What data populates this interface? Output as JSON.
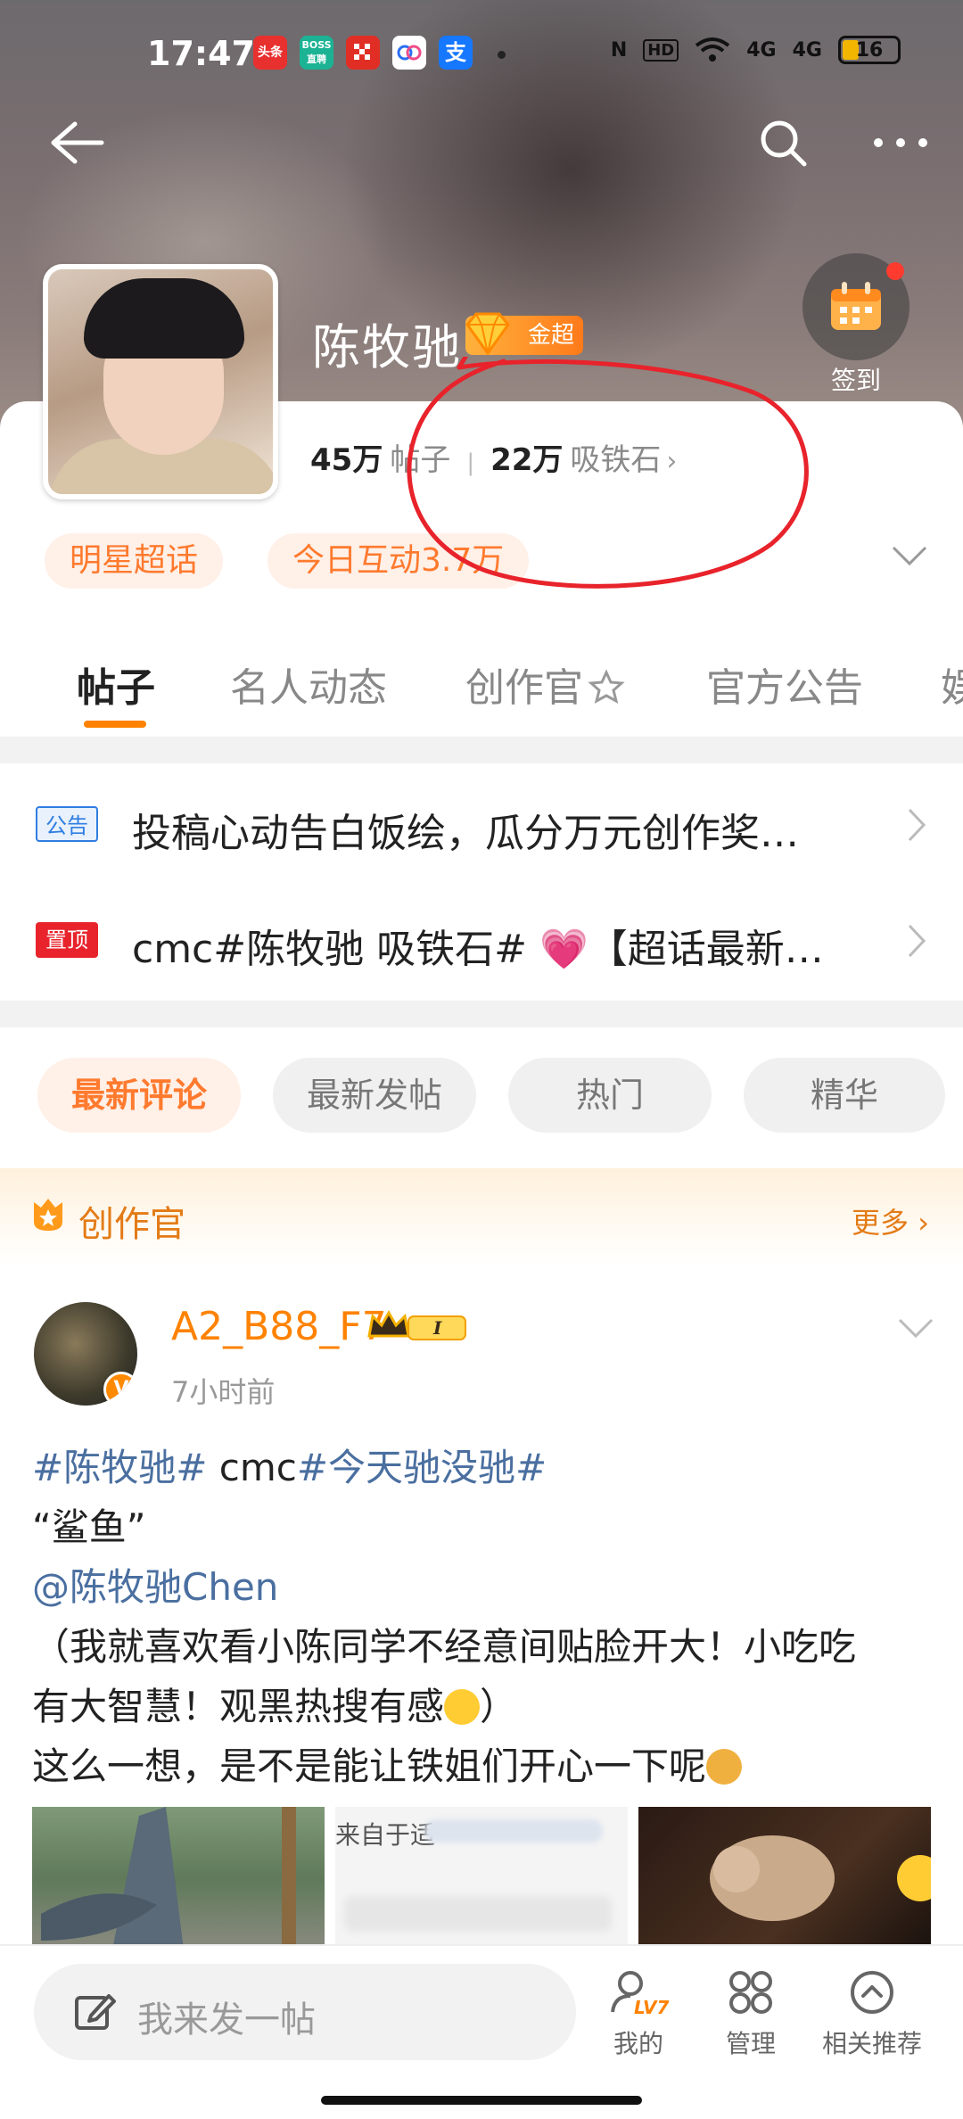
{
  "status_bar": {
    "time": "17:47",
    "apps": [
      "头条",
      "BOSS直聘",
      "多多",
      "百度网盘",
      "支"
    ],
    "network": [
      "N",
      "HD",
      "4G",
      "4G"
    ],
    "battery": "16"
  },
  "header": {
    "name": "陈牧驰",
    "badge": "金超",
    "checkin_label": "签到",
    "posts_count": "45万",
    "posts_label": "帖子",
    "fans_count": "22万",
    "fans_label": "吸铁石"
  },
  "chips": [
    "明星超话",
    "今日互动3.7万"
  ],
  "tabs": [
    "帖子",
    "名人动态",
    "创作官",
    "官方公告",
    "娱"
  ],
  "notices": [
    {
      "tag": "公告",
      "text": "投稿心动告白饭绘，瓜分万元创作奖…"
    },
    {
      "tag": "置顶",
      "text": "cmc#陈牧驰 吸铁石#  💗【超话最新…"
    }
  ],
  "filters": [
    "最新评论",
    "最新发帖",
    "热门",
    "精华"
  ],
  "creator_section": {
    "title": "创作官",
    "more": "更多"
  },
  "post": {
    "username": "A2_B88_F7",
    "level_badge": "I",
    "time": "7小时前",
    "tag1": "#陈牧驰#",
    "plain1": " cmc",
    "tag2": "#今天驰没驰#",
    "line2": "“鲨鱼”",
    "mention": "@陈牧驰Chen",
    "line4a": "（我就喜欢看小陈同学不经意间贴脸开大！小吃吃",
    "line4b": "有大智慧！观黑热搜有感",
    "line4c": "）",
    "line5": "这么一想，是不是能让铁姐们开心一下呢",
    "image2_text": "来自于适"
  },
  "bottom_bar": {
    "compose_placeholder": "我来发一帖",
    "items": [
      "我的",
      "管理",
      "相关推荐"
    ],
    "level": "LV7"
  },
  "colors": {
    "accent_orange": "#ff8200",
    "chip_bg": "#fff0e8",
    "topic_blue": "#4a6fa0",
    "annotation_red": "#e8232b"
  }
}
